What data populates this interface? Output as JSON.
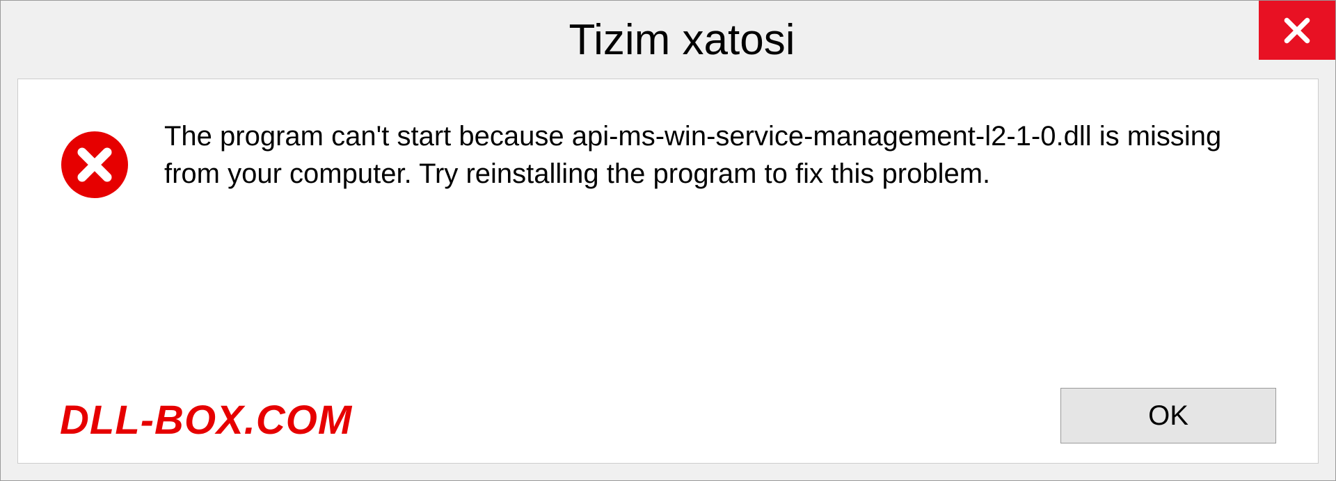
{
  "window": {
    "title": "Tizim xatosi"
  },
  "dialog": {
    "message": "The program can't start because api-ms-win-service-management-l2-1-0.dll is missing from your computer. Try reinstalling the program to fix this problem."
  },
  "footer": {
    "watermark": "DLL-BOX.COM",
    "ok_label": "OK"
  }
}
